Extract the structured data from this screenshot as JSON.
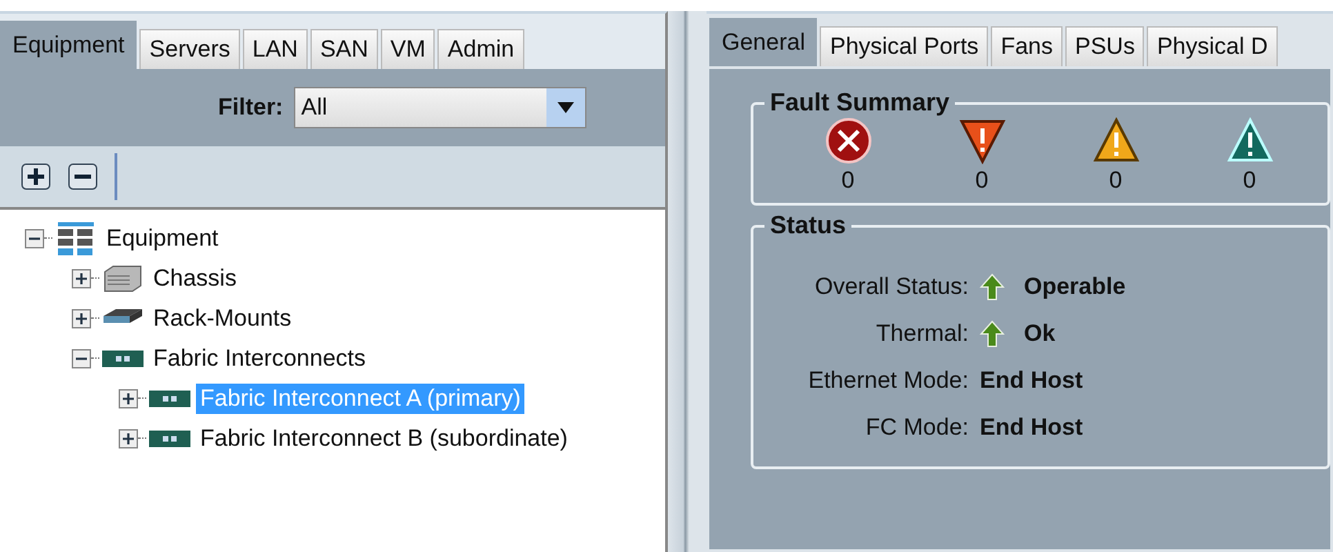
{
  "left_tabs": [
    {
      "label": "Equipment",
      "selected": true
    },
    {
      "label": "Servers",
      "selected": false
    },
    {
      "label": "LAN",
      "selected": false
    },
    {
      "label": "SAN",
      "selected": false
    },
    {
      "label": "VM",
      "selected": false
    },
    {
      "label": "Admin",
      "selected": false
    }
  ],
  "filter": {
    "label": "Filter:",
    "value": "All"
  },
  "tree": [
    {
      "label": "Equipment",
      "kind": "equipment",
      "expanded": true,
      "selected": false,
      "children": [
        {
          "label": "Chassis",
          "kind": "chassis",
          "expanded": false,
          "selected": false
        },
        {
          "label": "Rack-Mounts",
          "kind": "rack",
          "expanded": false,
          "selected": false
        },
        {
          "label": "Fabric Interconnects",
          "kind": "interconnect",
          "expanded": true,
          "selected": false,
          "children": [
            {
              "label": "Fabric Interconnect A (primary)",
              "kind": "interconnect",
              "expanded": false,
              "selected": true
            },
            {
              "label": "Fabric Interconnect B (subordinate)",
              "kind": "interconnect",
              "expanded": false,
              "selected": false
            }
          ]
        }
      ]
    }
  ],
  "right_tabs": [
    {
      "label": "General",
      "selected": true
    },
    {
      "label": "Physical Ports",
      "selected": false
    },
    {
      "label": "Fans",
      "selected": false
    },
    {
      "label": "PSUs",
      "selected": false
    },
    {
      "label": "Physical D",
      "selected": false
    }
  ],
  "fault_summary": {
    "title": "Fault Summary",
    "faults": [
      {
        "kind": "critical",
        "count": "0"
      },
      {
        "kind": "major",
        "count": "0"
      },
      {
        "kind": "minor",
        "count": "0"
      },
      {
        "kind": "warning",
        "count": "0"
      }
    ]
  },
  "status": {
    "title": "Status",
    "rows": [
      {
        "label": "Overall Status:",
        "value": "Operable",
        "arrow": true
      },
      {
        "label": "Thermal:",
        "value": "Ok",
        "arrow": true
      },
      {
        "label": "Ethernet Mode:",
        "value": "End Host",
        "arrow": false
      },
      {
        "label": "FC Mode:",
        "value": "End Host",
        "arrow": false
      }
    ]
  }
}
